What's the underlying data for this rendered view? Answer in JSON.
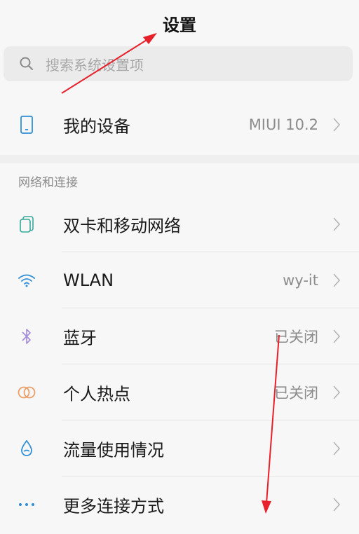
{
  "header": {
    "title": "设置"
  },
  "search": {
    "placeholder": "搜索系统设置项"
  },
  "device_row": {
    "label": "我的设备",
    "value": "MIUI 10.2",
    "icon": "phone-icon"
  },
  "network_section": {
    "header": "网络和连接",
    "items": [
      {
        "label": "双卡和移动网络",
        "value": "",
        "icon": "sim-card-icon"
      },
      {
        "label": "WLAN",
        "value": "wy-it",
        "icon": "wifi-icon"
      },
      {
        "label": "蓝牙",
        "value": "已关闭",
        "icon": "bluetooth-icon"
      },
      {
        "label": "个人热点",
        "value": "已关闭",
        "icon": "hotspot-icon"
      },
      {
        "label": "流量使用情况",
        "value": "",
        "icon": "data-usage-icon"
      },
      {
        "label": "更多连接方式",
        "value": "",
        "icon": "more-dots-icon"
      }
    ]
  },
  "colors": {
    "icon_blue": "#2f8fd8",
    "icon_green": "#35a89a",
    "icon_purple": "#a28ad8",
    "icon_orange": "#e9a06a",
    "annotation_red": "#e8202a"
  }
}
